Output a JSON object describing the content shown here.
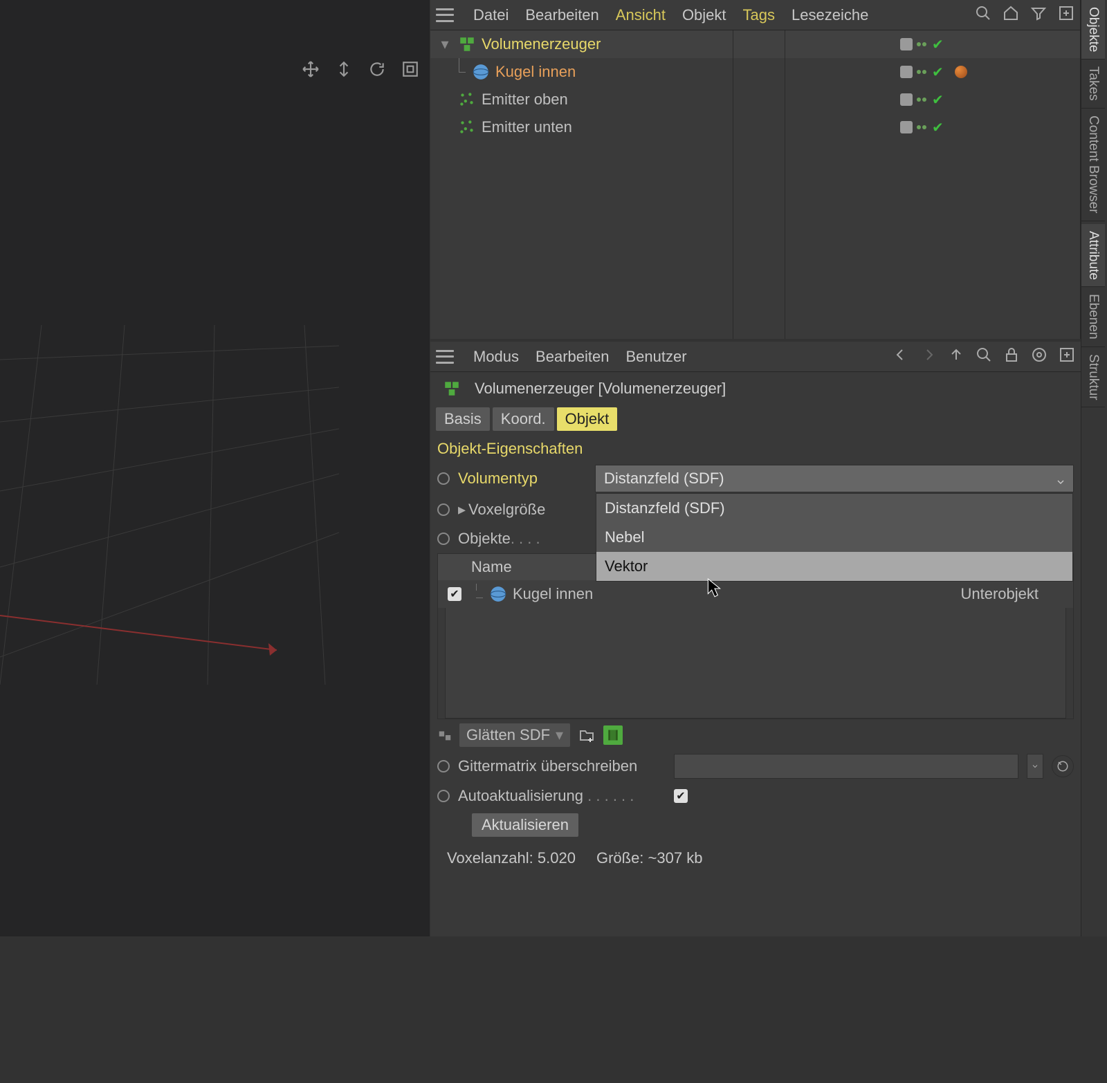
{
  "obj_menu": {
    "file": "Datei",
    "edit": "Bearbeiten",
    "view": "Ansicht",
    "object": "Objekt",
    "tags": "Tags",
    "bookmark": "Lesezeiche"
  },
  "dock": {
    "objects": "Objekte",
    "takes": "Takes",
    "content": "Content Browser",
    "attribute": "Attribute",
    "layers": "Ebenen",
    "structure": "Struktur"
  },
  "tree": [
    {
      "name": "Volumenerzeuger"
    },
    {
      "name": "Kugel innen"
    },
    {
      "name": "Emitter oben"
    },
    {
      "name": "Emitter unten"
    }
  ],
  "attr_menu": {
    "mode": "Modus",
    "edit": "Bearbeiten",
    "user": "Benutzer"
  },
  "attr_header": "Volumenerzeuger [Volumenerzeuger]",
  "attr_tabs": {
    "basis": "Basis",
    "coord": "Koord.",
    "object": "Objekt"
  },
  "section": "Objekt-Eigenschaften",
  "props": {
    "voltype": "Volumentyp",
    "voxel": "Voxelgröße",
    "objects": "Objekte",
    "objects_dots": ". . . .",
    "smooth": "Glätten SDF",
    "gitter": "Gittermatrix überschreiben",
    "auto": "Autoaktualisierung",
    "auto_dots": ". . . . . .",
    "update": "Aktualisieren"
  },
  "dropdown": {
    "selected": "Distanzfeld (SDF)",
    "options": [
      "Distanzfeld (SDF)",
      "Nebel",
      "Vektor"
    ]
  },
  "objlist": {
    "header_name": "Name",
    "row_name": "Kugel innen",
    "row_mode": "Unterobjekt"
  },
  "stats": {
    "voxels_label": "Voxelanzahl:",
    "voxels_value": "5.020",
    "size_label": "Größe:",
    "size_value": "~307 kb"
  }
}
